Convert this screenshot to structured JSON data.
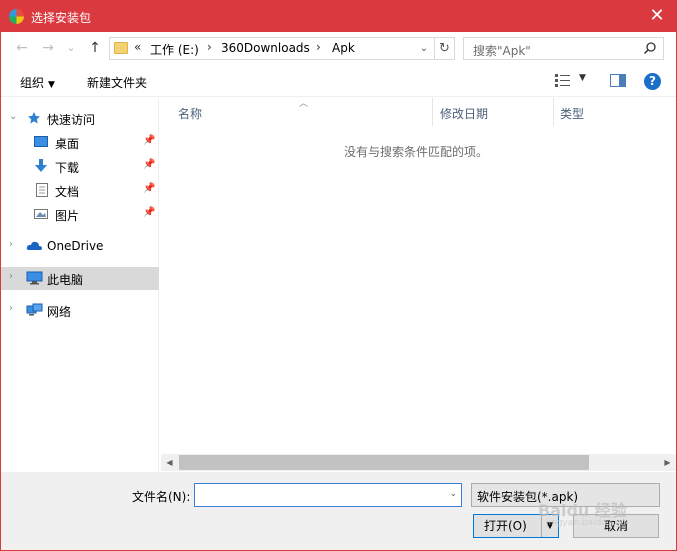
{
  "window": {
    "title": "选择安装包",
    "close_glyph": "✕"
  },
  "nav": {
    "back_glyph": "←",
    "forward_glyph": "→",
    "recent_glyph": "⌄",
    "up_glyph": "↑",
    "address": {
      "overflow": "«",
      "segments": [
        "工作 (E:)",
        "360Downloads",
        "Apk"
      ],
      "separator": "›",
      "dropdown_glyph": "⌄",
      "refresh_glyph": "↻"
    },
    "search_placeholder": "搜索\"Apk\""
  },
  "toolbar": {
    "organize": "组织",
    "new_folder": "新建文件夹",
    "help": "?"
  },
  "sidebar": {
    "quick_access": "快速访问",
    "items": [
      {
        "label": "桌面",
        "icon": "desktop-icon"
      },
      {
        "label": "下载",
        "icon": "download-icon"
      },
      {
        "label": "文档",
        "icon": "document-icon"
      },
      {
        "label": "图片",
        "icon": "pictures-icon"
      }
    ],
    "onedrive": "OneDrive",
    "this_pc": "此电脑",
    "network": "网络"
  },
  "list": {
    "columns": [
      "名称",
      "修改日期",
      "类型"
    ],
    "empty_message": "没有与搜索条件匹配的项。"
  },
  "footer": {
    "filename_label": "文件名(N):",
    "filename_value": "",
    "filetype_selected": "软件安装包(*.apk)",
    "open_label": "打开(O)",
    "cancel_label": "取消"
  },
  "watermark": {
    "text": "Baidu 经验",
    "sub": "jingyan.baidu.com"
  },
  "colors": {
    "titlebar": "#d9393f",
    "accent": "#0078d7",
    "folder": "#f3d36f"
  }
}
